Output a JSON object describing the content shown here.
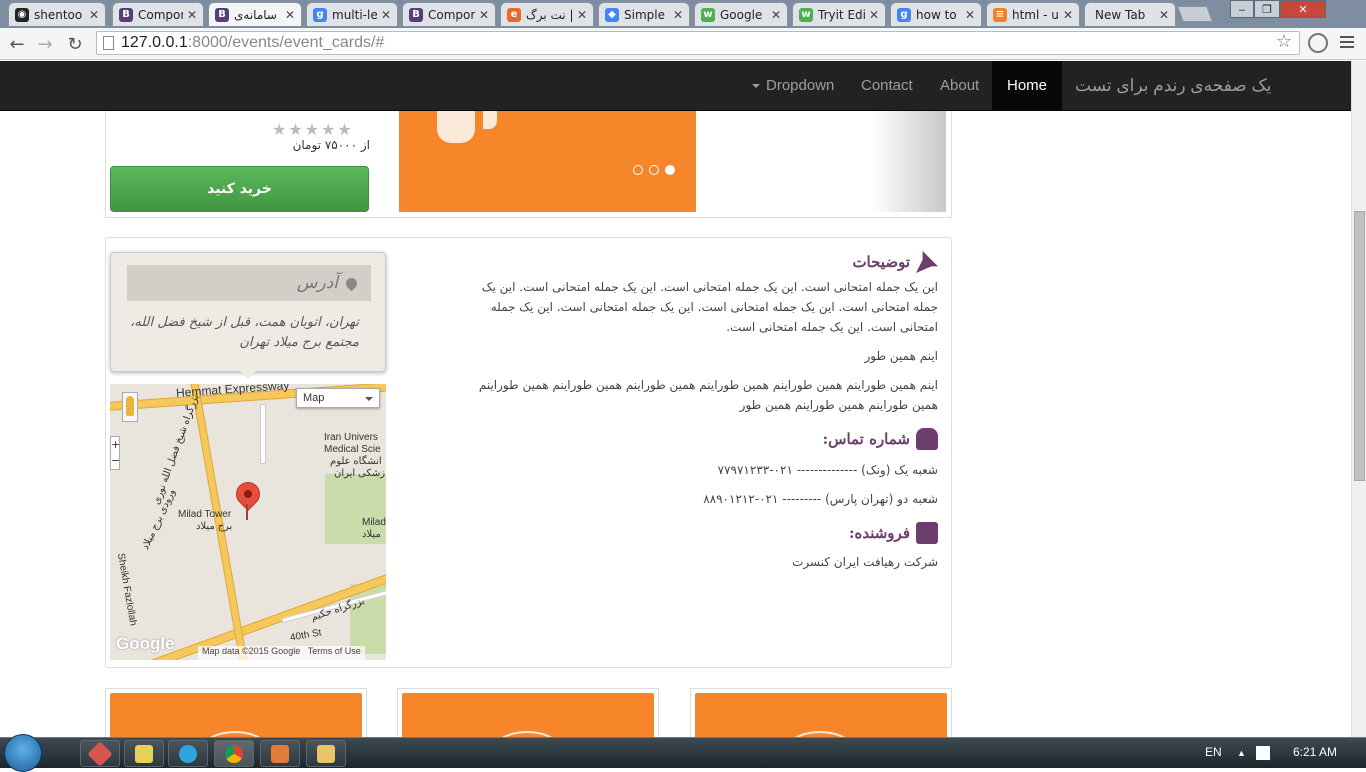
{
  "browser": {
    "tabs": [
      {
        "label": "shentoo",
        "fav_color": "#222",
        "fav_glyph": "◉"
      },
      {
        "label": "Compor",
        "fav_color": "#563d7c",
        "fav_glyph": "B"
      },
      {
        "label": "سامانه‌ی",
        "fav_color": "#563d7c",
        "fav_glyph": "B",
        "active": true
      },
      {
        "label": "multi-le",
        "fav_color": "#4285f4",
        "fav_glyph": "g"
      },
      {
        "label": "Compor",
        "fav_color": "#563d7c",
        "fav_glyph": "B"
      },
      {
        "label": "نت برگ |",
        "fav_color": "#e8692b",
        "fav_glyph": "e"
      },
      {
        "label": "Simple",
        "fav_color": "#4285f4",
        "fav_glyph": "◆"
      },
      {
        "label": "Google",
        "fav_color": "#4caf50",
        "fav_glyph": "w"
      },
      {
        "label": "Tryit Edi",
        "fav_color": "#4caf50",
        "fav_glyph": "w"
      },
      {
        "label": "how to",
        "fav_color": "#4285f4",
        "fav_glyph": "g"
      },
      {
        "label": "html - u",
        "fav_color": "#f48024",
        "fav_glyph": "≡"
      },
      {
        "label": "New Tab",
        "fav_color": "",
        "fav_glyph": ""
      }
    ],
    "url_host": "127.0.0.1",
    "url_rest": ":8000/events/event_cards/#",
    "window_controls": [
      "‒",
      "❐",
      "✕"
    ]
  },
  "navbar": {
    "brand": "یک صفحه‌ی رندم برای تست",
    "items": [
      "Home",
      "About",
      "Contact",
      "Dropdown"
    ]
  },
  "event": {
    "price": "از ۷۵۰۰۰ تومان",
    "rating_stars": "★★★★★",
    "rating": 0,
    "buy_label": "خرید کنید"
  },
  "address": {
    "title": "آدرس",
    "text": "تهران، اتوبان همت، قبل از شیخ فضل الله، مجتمع برج میلاد تهران"
  },
  "map": {
    "type": "Map",
    "labels": {
      "expressway": "Hemmat Expressway",
      "tower_en": "Milad Tower",
      "tower_fa": "برج میلاد",
      "iran_uni": "Iran Univers",
      "medical": "Medical Scie",
      "uni_fa1": "انشگاه علوم",
      "uni_fa2": "زشکی ایران",
      "milad_r1": "Milad",
      "milad_r2": "میلاد",
      "sheikh": "Sheikh Fazlollah",
      "hakim": "بزرگراه حکیم",
      "fortieth": "40th St",
      "side_fa": "بزرگراه شیخ فضل الله نوری",
      "tower_fa2": "ورودی برج میلاد"
    },
    "zoom_in": "+",
    "zoom_out": "−",
    "google": "Google",
    "footer_data": "Map data ©2015 Google",
    "footer_terms": "Terms of Use"
  },
  "description": {
    "title": "توضیحات",
    "p1": "این یک جمله امتحانی است. این یک جمله امتحانی است. این یک جمله امتحانی است. این یک جمله امتحانی است. این یک جمله امتحانی است. این یک جمله امتحانی است. این یک جمله امتحانی است. این یک جمله امتحانی است.",
    "p2": "اینم همین طور",
    "p3": "اینم همین طوراینم همین طوراینم همین طوراینم همین طوراینم همین طوراینم همین طوراینم همین طوراینم همین طوراینم همین طور"
  },
  "contact": {
    "title": "شماره تماس:",
    "branch1": "شعبه یک (ونک) -------------- ۰۲۱-۷۷۹۷۱۲۳۳",
    "branch2": "شعبه دو (تهران پارس) --------- ۰۲۱-۸۸۹۰۱۲۱۲"
  },
  "seller": {
    "title": "فروشنده:",
    "name": "شرکت رهیافت ایران کنسرت"
  },
  "taskbar": {
    "lang": "EN",
    "time": "6:21 AM",
    "tray_arrow": "▲",
    "apps": [
      {
        "name": "git-icon",
        "color": "#d9534f"
      },
      {
        "name": "notepad-icon",
        "color": "#e6d15a"
      },
      {
        "name": "telegram-icon",
        "color": "#2ca5e0"
      },
      {
        "name": "chrome-icon",
        "color": "#4caf50"
      },
      {
        "name": "paint-icon",
        "color": "#e07b39"
      },
      {
        "name": "folder-icon",
        "color": "#e8c56a"
      }
    ]
  }
}
